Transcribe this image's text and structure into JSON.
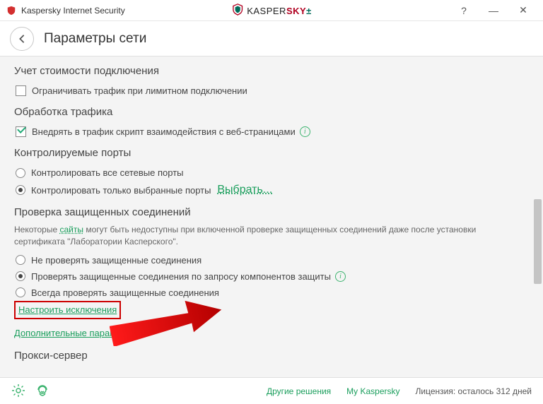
{
  "window": {
    "title": "Kaspersky Internet Security",
    "brand_wordmark_a": "KASPER",
    "brand_wordmark_b": "SKY",
    "brand_symbol": "±"
  },
  "page": {
    "title": "Параметры сети"
  },
  "sections": {
    "cost": {
      "title": "Учет стоимости подключения",
      "limit_traffic": "Ограничивать трафик при лимитном подключении"
    },
    "traffic": {
      "title": "Обработка трафика",
      "inject_script": "Внедрять в трафик скрипт взаимодействия с веб-страницами"
    },
    "ports": {
      "title": "Контролируемые порты",
      "all": "Контролировать все сетевые порты",
      "selected": "Контролировать только выбранные порты",
      "select_link": "Выбрать..."
    },
    "secure": {
      "title": "Проверка защищенных соединений",
      "desc_a": "Некоторые ",
      "desc_link": "сайты",
      "desc_b": " могут быть недоступны при включенной проверке защищенных соединений даже после установки сертификата \"Лаборатории Касперского\".",
      "opt_none": "Не проверять защищенные соединения",
      "opt_request": "Проверять защищенные соединения по запросу компонентов защиты",
      "opt_always": "Всегда проверять защищенные соединения",
      "config_exclusions": "Настроить исключения",
      "additional": "Дополнительные параметры"
    },
    "proxy": {
      "title": "Прокси-сервер"
    }
  },
  "footer": {
    "other_solutions": "Другие решения",
    "my_kaspersky": "My Kaspersky",
    "license_prefix": "Лицензия: осталось ",
    "license_days": "312",
    "license_suffix": " дней"
  }
}
